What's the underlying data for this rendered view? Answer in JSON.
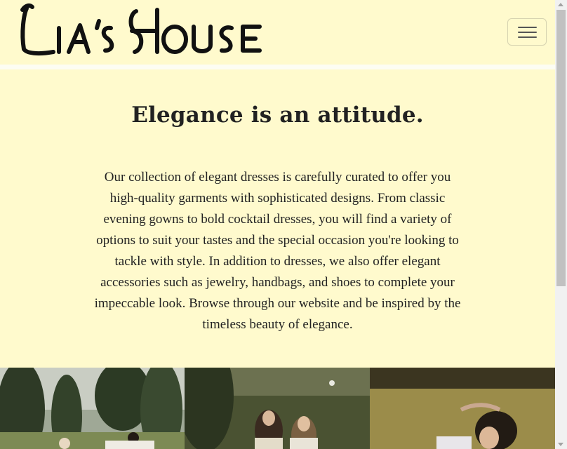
{
  "brand": {
    "name": "Lia's House"
  },
  "navbar": {
    "toggler_icon": "hamburger-menu-icon"
  },
  "hero": {
    "title": "Elegance is an attitude.",
    "text": "Our collection of elegant dresses is carefully curated to offer you high-quality garments with sophisticated designs. From classic evening gowns to bold cocktail dresses, you will find a variety of options to suit your tastes and the special occasion you're looking to tackle with style. In addition to dresses, we also offer elegant accessories such as jewelry, handbags, and shoes to complete your impeccable look. Browse through our website and be inspired by the timeless beauty of elegance."
  },
  "gallery": {
    "photos": [
      {
        "subject": "women-in-dresses-by-cypress-trees"
      },
      {
        "subject": "women-walking-on-hillside"
      },
      {
        "subject": "woman-lying-in-grass"
      }
    ]
  },
  "colors": {
    "background": "#fffacd",
    "text": "#222222"
  }
}
